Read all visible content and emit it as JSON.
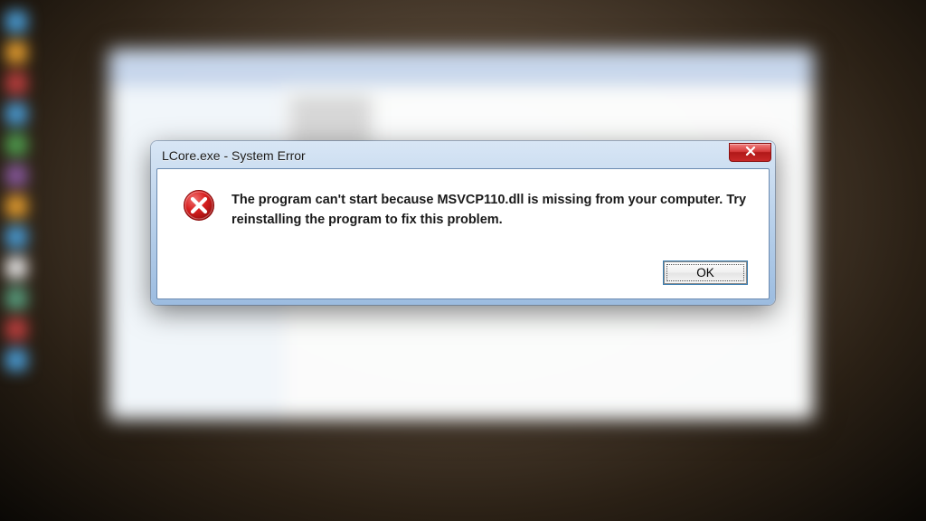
{
  "dialog": {
    "title": "LCore.exe - System Error",
    "message": "The program can't start because MSVCP110.dll is missing from your computer. Try reinstalling the program to fix this problem.",
    "ok_label": "OK",
    "close_label": "✕",
    "icon": "error-icon"
  }
}
